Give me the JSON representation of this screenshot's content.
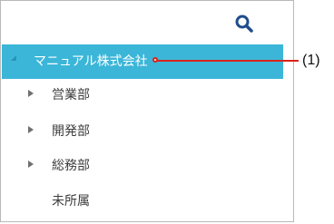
{
  "tree": {
    "root": {
      "label": "マニュアル株式会社",
      "expanded": true
    },
    "children": [
      {
        "label": "営業部",
        "has_children": true
      },
      {
        "label": "開発部",
        "has_children": true
      },
      {
        "label": "総務部",
        "has_children": true
      },
      {
        "label": "未所属",
        "has_children": false
      }
    ]
  },
  "icons": {
    "search": "search-icon",
    "expanded": "triangle-down-icon",
    "collapsed": "triangle-right-icon"
  },
  "annotation": {
    "label": "(1)"
  },
  "colors": {
    "selection": "#3bb6d8",
    "selection_text": "#ffffff",
    "text": "#3d3d3d",
    "icon": "#1f4e8c",
    "callout": "#d9241b",
    "border": "#b9b9b9"
  }
}
